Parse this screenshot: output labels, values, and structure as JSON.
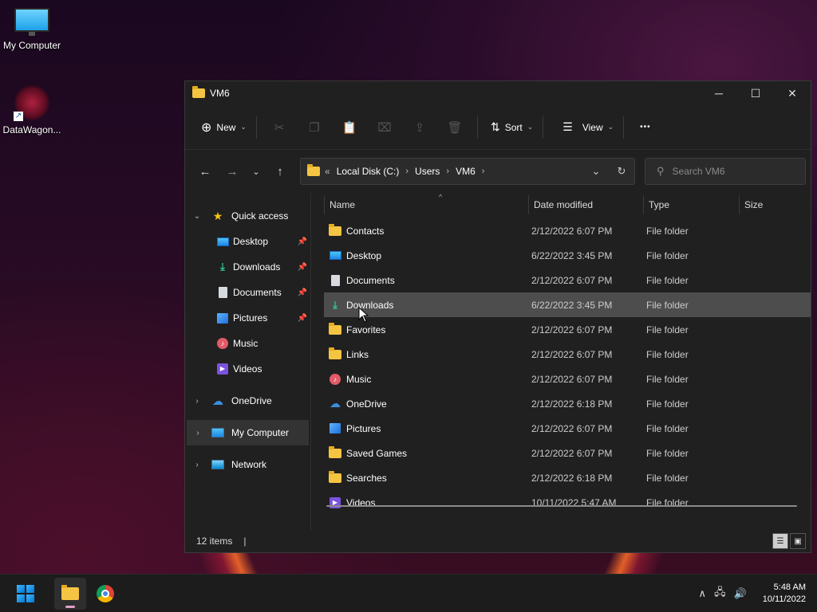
{
  "desktop": {
    "icons": [
      {
        "label": "My Computer"
      },
      {
        "label": "DataWagon..."
      }
    ]
  },
  "window": {
    "title": "VM6",
    "controls": {
      "minimize": "─",
      "maximize": "☐",
      "close": "✕"
    }
  },
  "toolbar": {
    "new_label": "New",
    "sort_label": "Sort",
    "view_label": "View",
    "more_label": "•••"
  },
  "address": {
    "overflow": "«",
    "crumbs": [
      "Local Disk (C:)",
      "Users",
      "VM6"
    ]
  },
  "search": {
    "placeholder": "Search VM6"
  },
  "sidebar": {
    "quick_access": "Quick access",
    "pinned": [
      {
        "label": "Desktop",
        "icon": "desktop-icon",
        "pinned": true
      },
      {
        "label": "Downloads",
        "icon": "downloads-icon",
        "pinned": true
      },
      {
        "label": "Documents",
        "icon": "documents-icon",
        "pinned": true
      },
      {
        "label": "Pictures",
        "icon": "pictures-icon",
        "pinned": true
      },
      {
        "label": "Music",
        "icon": "music-icon",
        "pinned": false
      },
      {
        "label": "Videos",
        "icon": "videos-icon",
        "pinned": false
      }
    ],
    "onedrive": "OneDrive",
    "my_computer": "My Computer",
    "network": "Network"
  },
  "columns": {
    "name": "Name",
    "date": "Date modified",
    "type": "Type",
    "size": "Size"
  },
  "files": [
    {
      "name": "Contacts",
      "date": "2/12/2022 6:07 PM",
      "type": "File folder",
      "icon": "folder-icon"
    },
    {
      "name": "Desktop",
      "date": "6/22/2022 3:45 PM",
      "type": "File folder",
      "icon": "desktop-icon"
    },
    {
      "name": "Documents",
      "date": "2/12/2022 6:07 PM",
      "type": "File folder",
      "icon": "documents-icon"
    },
    {
      "name": "Downloads",
      "date": "6/22/2022 3:45 PM",
      "type": "File folder",
      "icon": "downloads-icon"
    },
    {
      "name": "Favorites",
      "date": "2/12/2022 6:07 PM",
      "type": "File folder",
      "icon": "folder-icon"
    },
    {
      "name": "Links",
      "date": "2/12/2022 6:07 PM",
      "type": "File folder",
      "icon": "folder-icon"
    },
    {
      "name": "Music",
      "date": "2/12/2022 6:07 PM",
      "type": "File folder",
      "icon": "music-icon"
    },
    {
      "name": "OneDrive",
      "date": "2/12/2022 6:18 PM",
      "type": "File folder",
      "icon": "onedrive-icon"
    },
    {
      "name": "Pictures",
      "date": "2/12/2022 6:07 PM",
      "type": "File folder",
      "icon": "pictures-icon"
    },
    {
      "name": "Saved Games",
      "date": "2/12/2022 6:07 PM",
      "type": "File folder",
      "icon": "folder-icon"
    },
    {
      "name": "Searches",
      "date": "2/12/2022 6:18 PM",
      "type": "File folder",
      "icon": "folder-icon"
    },
    {
      "name": "Videos",
      "date": "10/11/2022 5:47 AM",
      "type": "File folder",
      "icon": "videos-icon"
    }
  ],
  "status": {
    "item_count": "12 items",
    "caret": "|"
  },
  "taskbar": {
    "clock_time": "5:48 AM",
    "clock_date": "10/11/2022"
  }
}
